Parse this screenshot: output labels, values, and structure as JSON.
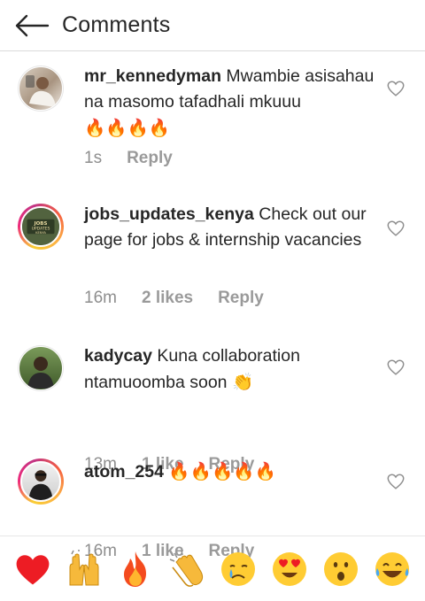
{
  "header": {
    "title": "Comments"
  },
  "comments": [
    {
      "username": "mr_kennedyman",
      "text": "Mwambie asisahau na masomo tafadhali mkuuu",
      "emoji": "🔥🔥🔥🔥",
      "time": "1s",
      "likes": "",
      "reply": "Reply"
    },
    {
      "username": "jobs_updates_kenya",
      "text": "Check out our page for jobs & internship vacancies",
      "emoji": "",
      "time": "16m",
      "likes": "2 likes",
      "reply": "Reply"
    },
    {
      "username": "kadycay",
      "text": "Kuna collaboration ntamuoomba soon",
      "emoji": "👏",
      "time": "13m",
      "likes": "1 like",
      "reply": "Reply"
    },
    {
      "username": "atom_254",
      "text": "",
      "emoji": "🔥🔥🔥🔥🔥",
      "time": "16m",
      "likes": "1 like",
      "reply": "Reply"
    }
  ],
  "reactions": [
    "❤️",
    "🙌",
    "🔥",
    "👏",
    "😢",
    "😍",
    "😮",
    "😂"
  ],
  "colors": {
    "text": "#262626",
    "muted": "#8e8e8e",
    "divider": "#dbdbdb",
    "heart_red": "#ed1c24"
  }
}
